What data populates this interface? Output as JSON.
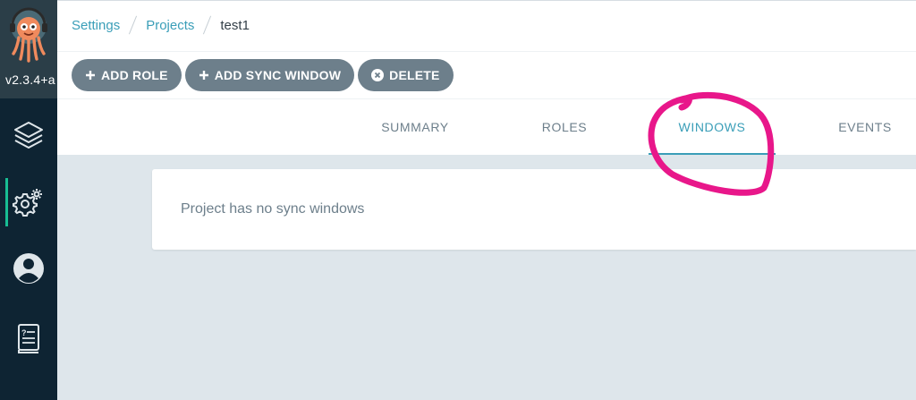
{
  "sidebar": {
    "version": "v2.3.4+a",
    "nav": [
      {
        "name": "applications",
        "icon": "layers-icon",
        "active": false
      },
      {
        "name": "settings",
        "icon": "gear-icon",
        "active": true
      },
      {
        "name": "user-info",
        "icon": "user-circle-icon",
        "active": false
      },
      {
        "name": "documentation",
        "icon": "book-icon",
        "active": false
      }
    ]
  },
  "breadcrumb": {
    "items": [
      "Settings",
      "Projects"
    ],
    "current": "test1"
  },
  "toolbar": {
    "add_role": "ADD ROLE",
    "add_sync_window": "ADD SYNC WINDOW",
    "delete": "DELETE"
  },
  "tabs": [
    "SUMMARY",
    "ROLES",
    "WINDOWS",
    "EVENTS"
  ],
  "active_tab": "WINDOWS",
  "content": {
    "empty_message": "Project has no sync windows"
  },
  "colors": {
    "accent": "#3a9eb8",
    "sidebar_bg": "#0e2433",
    "button_bg": "#6d7f8b",
    "annotation": "#e8178a"
  }
}
